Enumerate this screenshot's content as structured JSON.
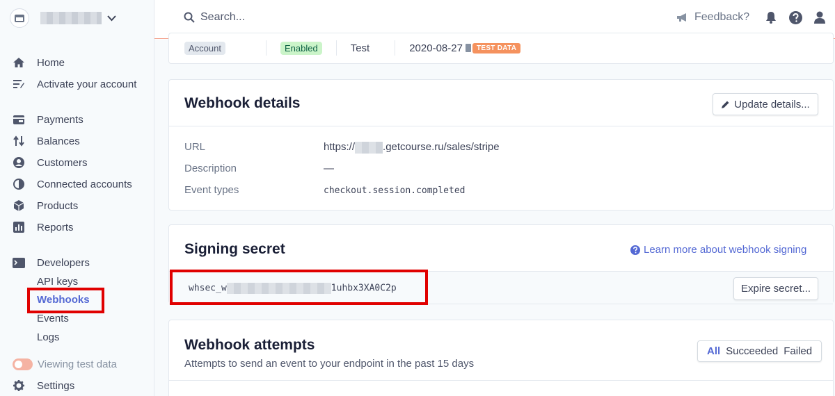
{
  "sidebar": {
    "nav": [
      {
        "label": "Home",
        "icon": "home-icon"
      },
      {
        "label": "Activate your account",
        "icon": "activate-icon"
      },
      {
        "label": "Payments",
        "icon": "payments-icon"
      },
      {
        "label": "Balances",
        "icon": "balances-icon"
      },
      {
        "label": "Customers",
        "icon": "customers-icon"
      },
      {
        "label": "Connected accounts",
        "icon": "connected-accounts-icon"
      },
      {
        "label": "Products",
        "icon": "products-icon"
      },
      {
        "label": "Reports",
        "icon": "reports-icon"
      },
      {
        "label": "Developers",
        "icon": "developers-icon"
      }
    ],
    "developer_sub": [
      "API keys",
      "Webhooks",
      "Events",
      "Logs"
    ],
    "test_toggle_label": "Viewing test data",
    "settings_label": "Settings"
  },
  "header": {
    "search_placeholder": "Search...",
    "feedback_label": "Feedback?"
  },
  "summary": {
    "account_pill": "Account",
    "status_pill": "Enabled",
    "mode": "Test",
    "date": "2020-08-27",
    "test_badge": "TEST DATA"
  },
  "details": {
    "title": "Webhook details",
    "update_button": "Update details...",
    "rows": [
      {
        "label": "URL",
        "value_prefix": "https://",
        "value_suffix": ".getcourse.ru/sales/stripe"
      },
      {
        "label": "Description",
        "value": "—"
      },
      {
        "label": "Event types",
        "value": "checkout.session.completed"
      }
    ]
  },
  "secret": {
    "title": "Signing secret",
    "learn_link": "Learn more about webhook signing",
    "value_prefix": "whsec_w",
    "value_suffix": "1uhbx3XA0C2p",
    "expire_button": "Expire secret..."
  },
  "attempts": {
    "title": "Webhook attempts",
    "subtitle": "Attempts to send an event to your endpoint in the past 15 days",
    "filters": [
      "All",
      "Succeeded",
      "Failed"
    ]
  },
  "colors": {
    "accent": "#5469d4",
    "highlight": "#e00000",
    "test_badge": "#f5925e",
    "enabled": "#cbf4c9"
  }
}
